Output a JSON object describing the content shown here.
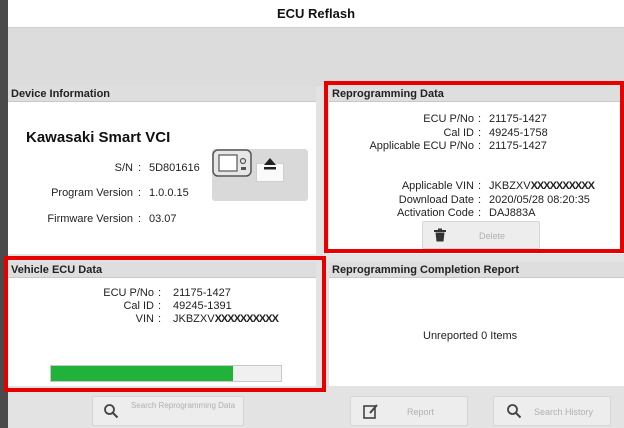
{
  "window": {
    "title": "ECU Reflash"
  },
  "device_info": {
    "header": "Device Information",
    "device_name": "Kawasaki Smart VCI",
    "sn_label": "S/N",
    "sn_value": "5D801616",
    "program_label": "Program Version",
    "program_value": "1.0.0.15",
    "firmware_label": "Firmware Version",
    "firmware_value": "03.07",
    "separator": ":"
  },
  "reprogramming_data": {
    "header": "Reprogramming Data",
    "ecu_pno_label": "ECU P/No",
    "ecu_pno_value": "21175-1427",
    "cal_id_label": "Cal ID",
    "cal_id_value": "49245-1758",
    "applicable_ecu_label": "Applicable ECU P/No",
    "applicable_ecu_value": "21175-1427",
    "applicable_vin_label": "Applicable VIN",
    "applicable_vin_prefix": "JKBZXV",
    "applicable_vin_masked": "XXXXXXXXXX",
    "download_date_label": "Download Date",
    "download_date_value": "2020/05/28 08:20:35",
    "activation_label": "Activation Code",
    "activation_value": "DAJ883A",
    "delete_label": "Delete"
  },
  "vehicle_ecu": {
    "header": "Vehicle ECU Data",
    "ecu_pno_label": "ECU P/No",
    "ecu_pno_value": "21175-1427",
    "cal_id_label": "Cal ID",
    "cal_id_value": "49245-1391",
    "vin_label": "VIN",
    "vin_prefix": "JKBZXV",
    "vin_masked": "XXXXXXXXXX",
    "progress": 0.79,
    "search_label": "Search Reprogramming Data"
  },
  "completion_report": {
    "header": "Reprogramming Completion Report",
    "status": "Unreported 0 Items",
    "report_label": "Report",
    "search_history_label": "Search History"
  },
  "colors": {
    "highlight": "#e60000",
    "progress": "#1fb33a"
  },
  "icons": [
    "eject-icon",
    "device-icon",
    "trash-icon",
    "search-icon",
    "edit-icon"
  ]
}
